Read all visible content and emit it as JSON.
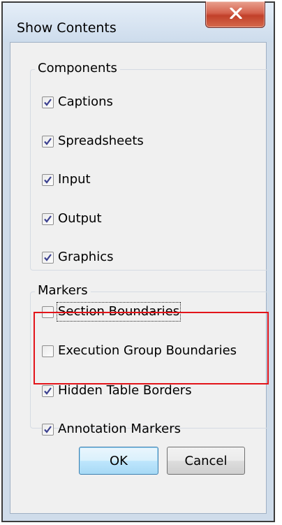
{
  "dialog": {
    "title": "Show Contents",
    "close_icon": "close-x-icon"
  },
  "components": {
    "legend": "Components",
    "items": [
      {
        "label": "Captions",
        "checked": true
      },
      {
        "label": "Spreadsheets",
        "checked": true
      },
      {
        "label": "Input",
        "checked": true
      },
      {
        "label": "Output",
        "checked": true
      },
      {
        "label": "Graphics",
        "checked": true
      }
    ]
  },
  "markers": {
    "legend": "Markers",
    "items": [
      {
        "label": "Section Boundaries",
        "checked": false
      },
      {
        "label": "Execution Group Boundaries",
        "checked": false
      },
      {
        "label": "Hidden Table Borders",
        "checked": true
      },
      {
        "label": "Annotation Markers",
        "checked": true
      }
    ]
  },
  "buttons": {
    "ok_label": "OK",
    "cancel_label": "Cancel"
  },
  "colors": {
    "highlight": "#e3141a",
    "check": "#3a3f8f",
    "close_button": "#c8462e"
  }
}
